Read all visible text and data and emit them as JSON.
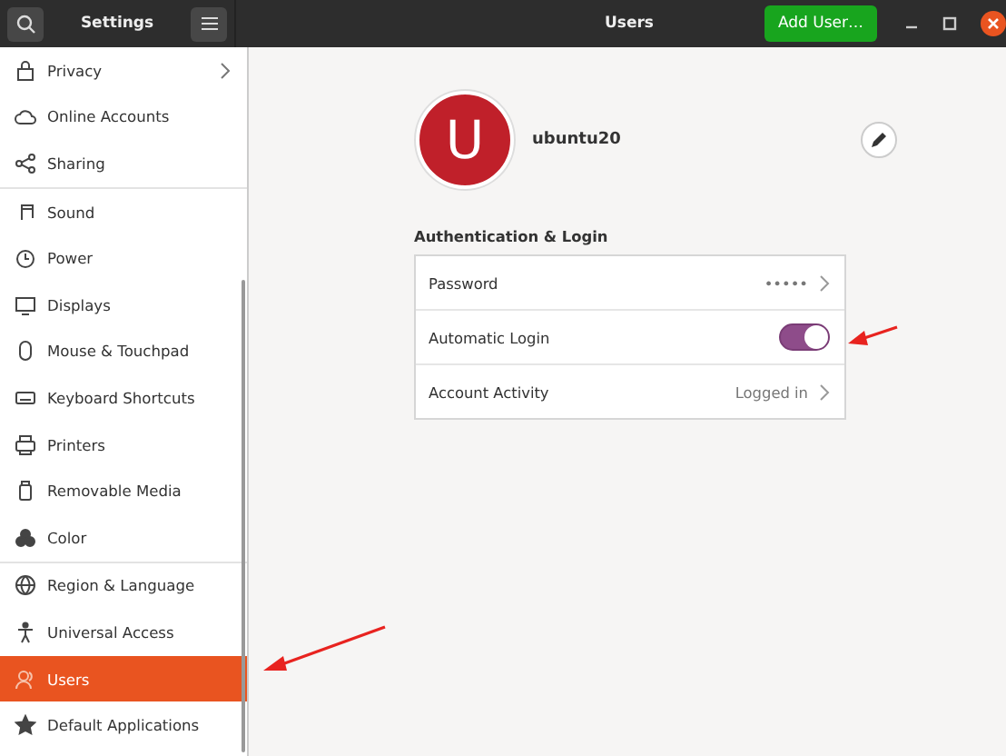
{
  "header": {
    "sidebar_title": "Settings",
    "title": "Users",
    "add_button": "Add User…"
  },
  "sidebar": {
    "groups": [
      {
        "items": [
          {
            "label": "Privacy",
            "selected": false,
            "has_submenu": true
          },
          {
            "label": "Online Accounts",
            "selected": false,
            "has_submenu": false
          },
          {
            "label": "Sharing",
            "selected": false,
            "has_submenu": false
          }
        ]
      },
      {
        "items": [
          {
            "label": "Sound",
            "selected": false,
            "has_submenu": false
          },
          {
            "label": "Power",
            "selected": false,
            "has_submenu": false
          },
          {
            "label": "Displays",
            "selected": false,
            "has_submenu": false
          },
          {
            "label": "Mouse & Touchpad",
            "selected": false,
            "has_submenu": false
          },
          {
            "label": "Keyboard Shortcuts",
            "selected": false,
            "has_submenu": false
          },
          {
            "label": "Printers",
            "selected": false,
            "has_submenu": false
          },
          {
            "label": "Removable Media",
            "selected": false,
            "has_submenu": false
          },
          {
            "label": "Color",
            "selected": false,
            "has_submenu": false
          }
        ]
      },
      {
        "items": [
          {
            "label": "Region & Language",
            "selected": false,
            "has_submenu": false
          },
          {
            "label": "Universal Access",
            "selected": false,
            "has_submenu": false
          },
          {
            "label": "Users",
            "selected": true,
            "has_submenu": false
          },
          {
            "label": "Default Applications",
            "selected": false,
            "has_submenu": false
          }
        ]
      }
    ]
  },
  "user": {
    "initial": "U",
    "name": "ubuntu20"
  },
  "section": {
    "title": "Authentication & Login",
    "rows": [
      {
        "kind": "link",
        "label": "Password",
        "value": "•••••"
      },
      {
        "kind": "switch",
        "label": "Automatic Login",
        "on": true
      },
      {
        "kind": "link",
        "label": "Account Activity",
        "value": "Logged in"
      }
    ]
  }
}
